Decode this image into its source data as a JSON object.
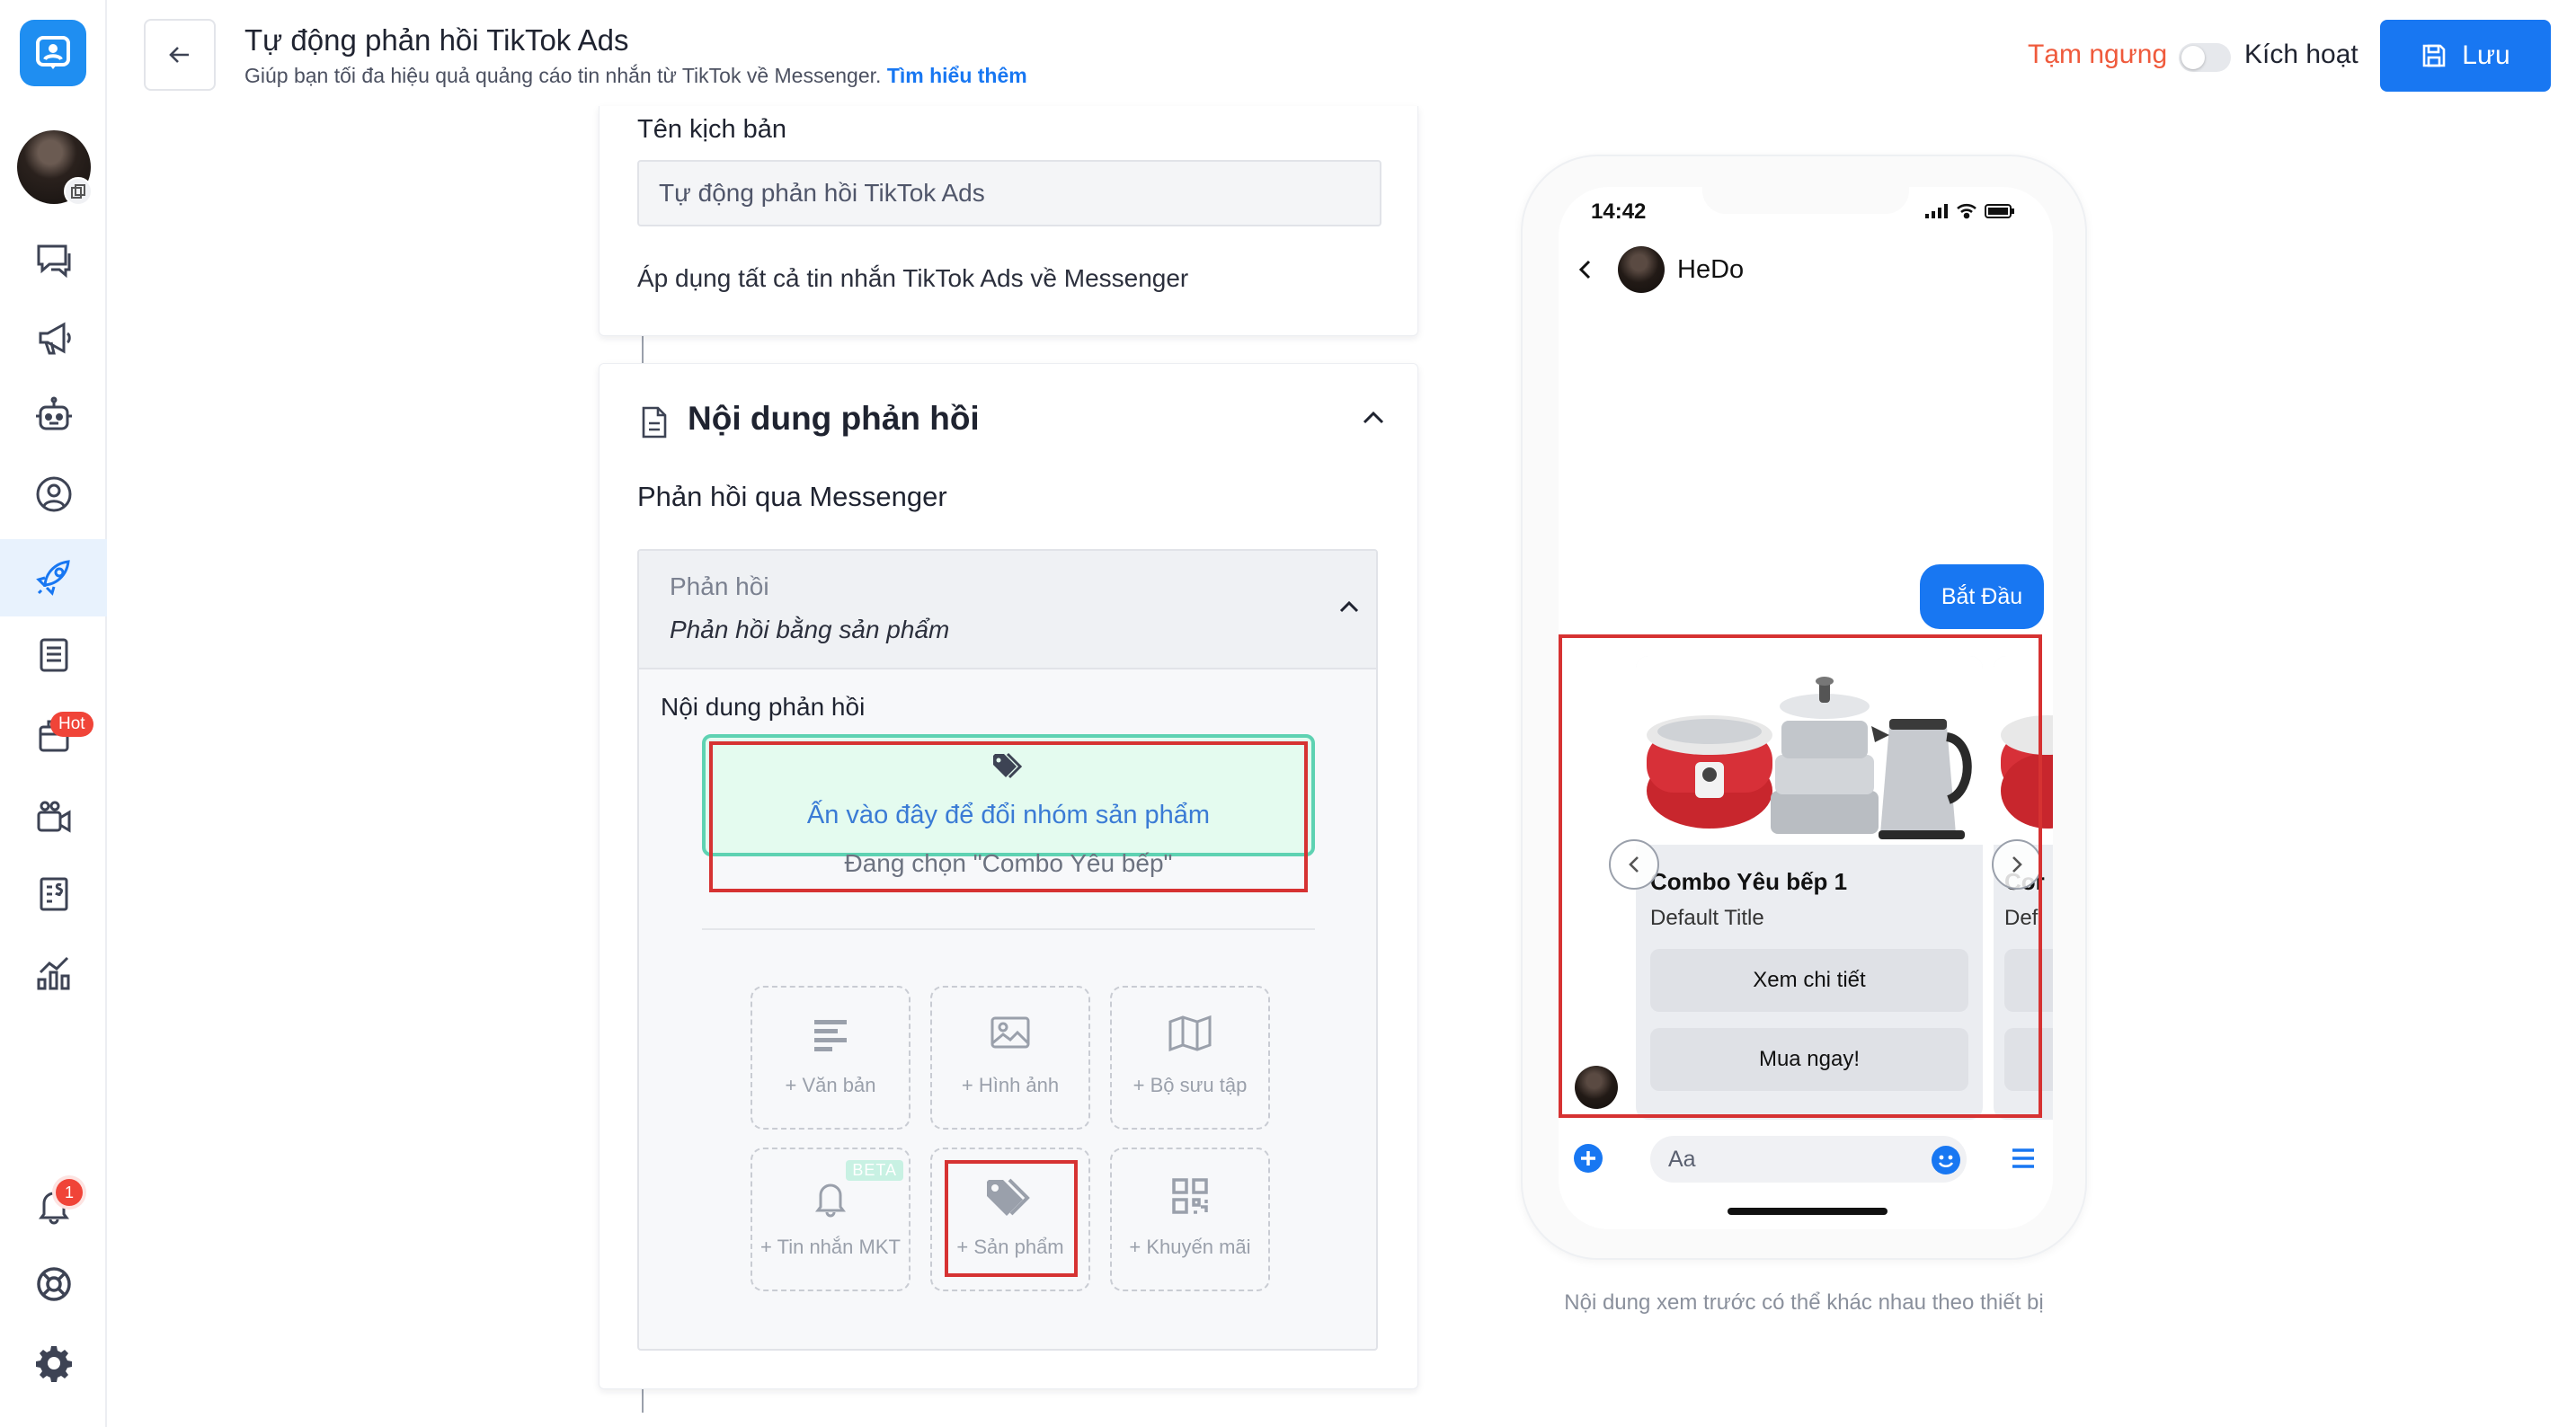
{
  "header": {
    "title": "Tự động phản hồi TikTok Ads",
    "subtitle": "Giúp bạn tối đa hiệu quả quảng cáo tin nhắn từ TikTok về Messenger.",
    "learn_more": "Tìm hiểu thêm",
    "pause_label": "Tạm ngưng",
    "active_label": "Kích hoạt",
    "save_label": "Lưu"
  },
  "sidebar": {
    "hot_badge": "Hot",
    "notification_count": "1",
    "items": [
      "logo-icon",
      "avatar",
      "chat-icon",
      "megaphone-icon",
      "bot-icon",
      "user-icon",
      "rocket-icon",
      "document-list-icon",
      "box-icon",
      "video-icon",
      "invoice-icon",
      "analytics-icon",
      "bell-icon",
      "help-icon",
      "gear-icon"
    ]
  },
  "scenario": {
    "name_label": "Tên kịch bản",
    "name_value": "Tự động phản hồi TikTok Ads",
    "apply_text": "Áp dụng tất cả tin nhắn TikTok Ads về Messenger"
  },
  "response": {
    "section_title": "Nội dung phản hồi",
    "channel_title": "Phản hồi qua Messenger",
    "reply_label": "Phản hồi",
    "reply_value": "Phản hồi bằng sản phẩm",
    "content_label": "Nội dung phản hồi",
    "select_product_link": "Ấn vào đây để đổi nhóm sản phẩm",
    "current_selection": "Đang chọn \"Combo Yêu bếp\"",
    "tiles": [
      {
        "label": "+ Văn bản",
        "icon": "text-icon"
      },
      {
        "label": "+ Hình ảnh",
        "icon": "image-icon"
      },
      {
        "label": "+ Bộ sưu tập",
        "icon": "map-icon"
      },
      {
        "label": "+ Tin nhắn MKT",
        "icon": "bell-icon",
        "badge": "BETA"
      },
      {
        "label": "+ Sản phẩm",
        "icon": "tag-icon"
      },
      {
        "label": "+ Khuyến mãi",
        "icon": "qr-icon"
      }
    ]
  },
  "preview": {
    "time": "14:42",
    "contact_name": "HeDo",
    "start_bubble": "Bắt Đầu",
    "product_title": "Combo Yêu bếp 1",
    "product_subtitle": "Default Title",
    "next_title": "Cor",
    "next_subtitle": "Def",
    "details_button": "Xem chi tiết",
    "buy_button": "Mua ngay!",
    "input_placeholder": "Aa",
    "note": "Nội dung xem trước có thể khác nhau theo thiết bị"
  },
  "colors": {
    "accent": "#1877f2",
    "pause": "#ef5a3c",
    "highlight_border": "#d63232",
    "selector_bg": "#e4fbef",
    "selector_border": "#5ed2b2"
  }
}
